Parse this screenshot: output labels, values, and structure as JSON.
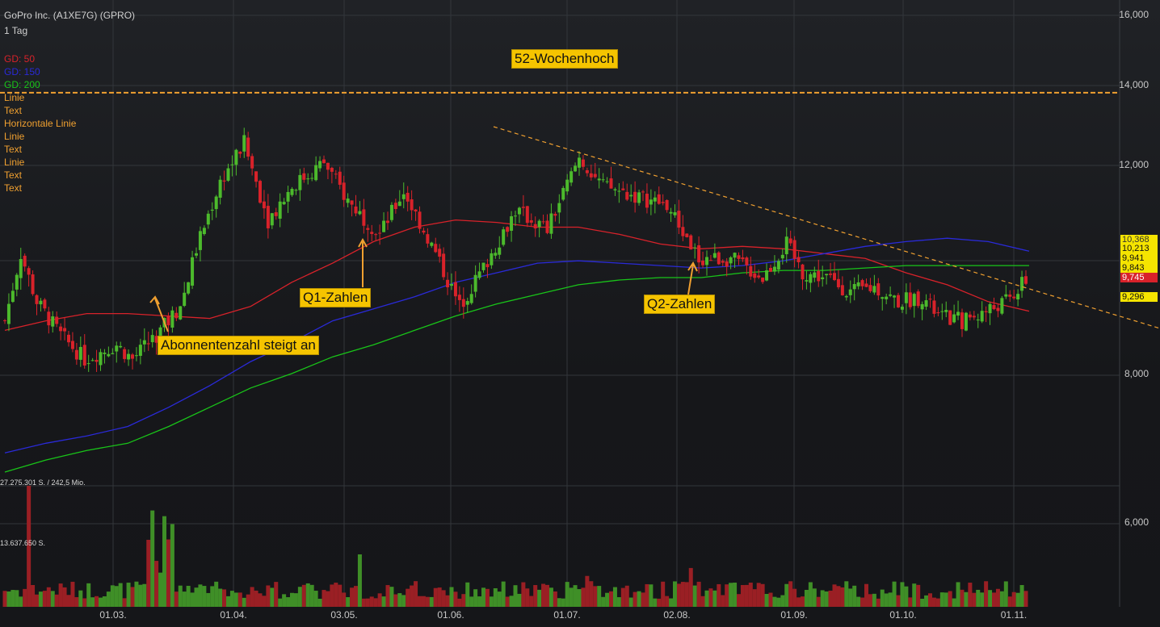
{
  "header": {
    "title": "GoPro Inc. (A1XE7G) (GPRO)",
    "interval": "1 Tag",
    "indicators": [
      {
        "label": "GD: 50",
        "color": "#d8222a"
      },
      {
        "label": "GD: 150",
        "color": "#2a2ad8"
      },
      {
        "label": "GD: 200",
        "color": "#19c419"
      }
    ],
    "drawings": [
      "Linie",
      "Text",
      "Horizontale Linie",
      "Linie",
      "Text",
      "Linie",
      "Text",
      "Text"
    ]
  },
  "annotations": {
    "high52": "52-Wochenhoch",
    "q1": "Q1-Zahlen",
    "q2": "Q2-Zahlen",
    "subscribers": "Abonnentenzahl steigt an"
  },
  "volume": {
    "max_label": "27.275.301 S. / 242,5 Mio.",
    "mid_label": "13.637.650 S."
  },
  "price_boxes": {
    "ma150": {
      "value": "10,368",
      "color": "#ffffff",
      "bg": "#f5e400"
    },
    "ma200": {
      "value": "10,213",
      "color": "#111111",
      "bg": "#f5e400"
    },
    "close": {
      "value": "9,941",
      "color": "#111111",
      "bg": "#f5e400"
    },
    "low": {
      "value": "9,843",
      "color": "#111111",
      "bg": "#f5e400"
    },
    "ma50": {
      "value": "9,745",
      "color": "#ffffff",
      "bg": "#d8222a"
    },
    "trend": {
      "value": "9,296",
      "color": "#111111",
      "bg": "#f5e400"
    }
  },
  "chart_data": {
    "type": "candlestick",
    "y_ticks": [
      "16,000",
      "14,000",
      "12,000",
      "8,000",
      "6,000"
    ],
    "y_tick_values": [
      16,
      14,
      12,
      8,
      6
    ],
    "x_ticks": [
      "01.03.",
      "01.04.",
      "03.05.",
      "01.06.",
      "01.07.",
      "02.08.",
      "01.09.",
      "01.10.",
      "01.11."
    ],
    "high_52_week": 13.85,
    "colors": {
      "up": "#4cba2c",
      "down": "#d8222a",
      "ma50": "#d8222a",
      "ma150": "#2a2ad8",
      "ma200": "#19c419",
      "trendline": "#f0a030"
    },
    "ma50": [
      8.9,
      9.1,
      9.25,
      9.25,
      9.2,
      9.15,
      9.4,
      9.9,
      10.3,
      10.75,
      11.05,
      11.2,
      11.15,
      11.05,
      11.05,
      10.9,
      10.7,
      10.6,
      10.65,
      10.6,
      10.5,
      10.4,
      10.1,
      9.85,
      9.5,
      9.3
    ],
    "ma150": [
      6.35,
      6.55,
      6.7,
      6.9,
      7.3,
      7.75,
      8.25,
      8.65,
      9.1,
      9.35,
      9.6,
      9.9,
      10.1,
      10.3,
      10.35,
      10.3,
      10.25,
      10.2,
      10.25,
      10.35,
      10.5,
      10.65,
      10.75,
      10.82,
      10.75,
      10.55
    ],
    "ma200": [
      5.95,
      6.2,
      6.4,
      6.55,
      6.9,
      7.3,
      7.7,
      8.0,
      8.35,
      8.6,
      8.9,
      9.2,
      9.45,
      9.65,
      9.85,
      9.95,
      10.0,
      10.0,
      10.1,
      10.15,
      10.15,
      10.2,
      10.25,
      10.25,
      10.25,
      10.25
    ]
  }
}
